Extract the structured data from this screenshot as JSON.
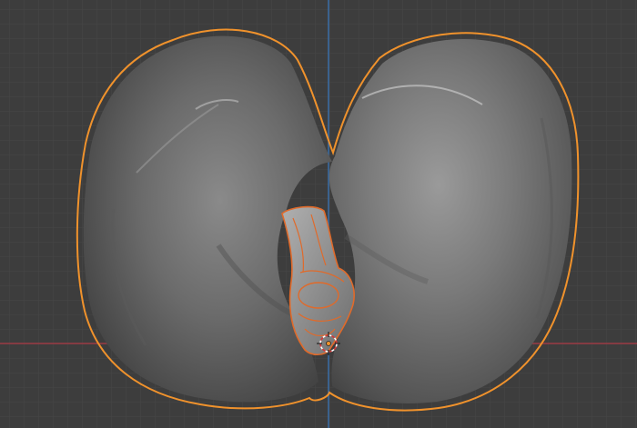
{
  "viewport": {
    "background": "#3d3d3d",
    "grid_minor_color": "#474747",
    "grid_major_color": "#333333",
    "x_axis_color": "#9b3b45",
    "z_axis_color": "#3b6ea8"
  },
  "selection": {
    "outline_color": "#f0922c",
    "active_outline_color": "#e06a2a",
    "origin_marker": "object-origin-icon",
    "3d_cursor": "3d-cursor-icon"
  },
  "objects": [
    {
      "name": "shell-left-lobe"
    },
    {
      "name": "shell-right-lobe"
    },
    {
      "name": "hinge-piece"
    }
  ]
}
